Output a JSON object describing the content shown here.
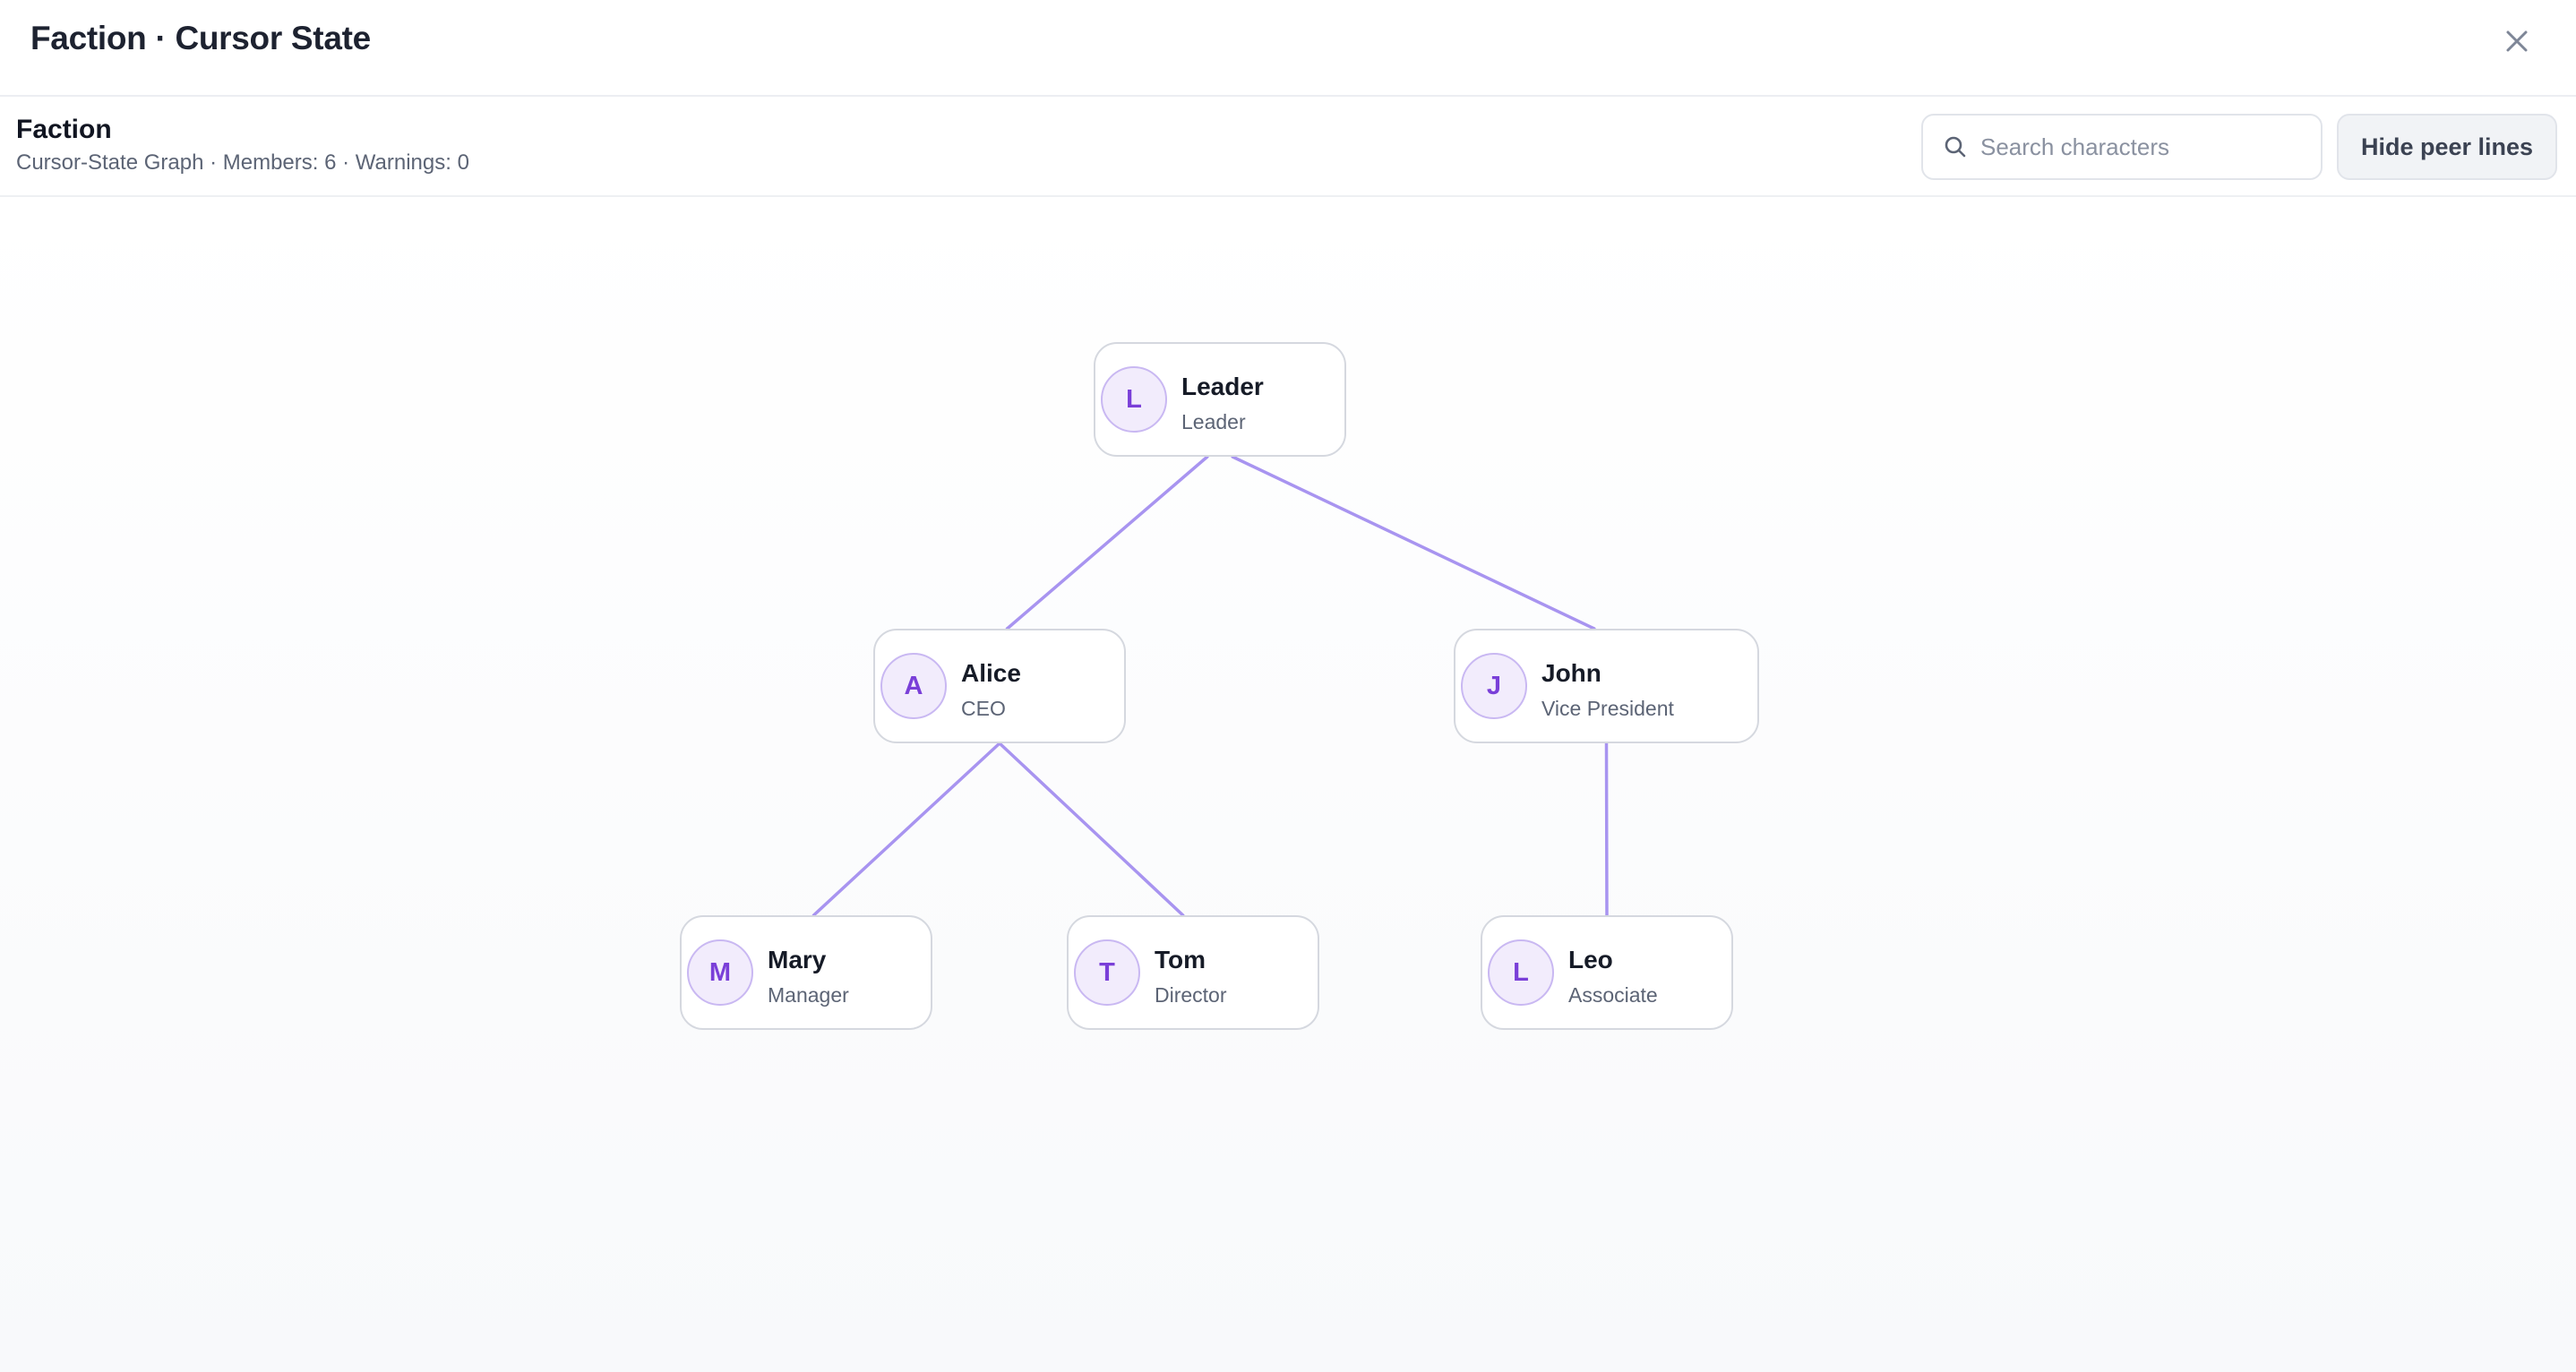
{
  "dialog": {
    "title": "Faction · Cursor State"
  },
  "toolbar": {
    "faction_name": "Faction",
    "meta": "Cursor-State Graph · Members: 6 · Warnings: 0",
    "search_placeholder": "Search characters",
    "search_value": "",
    "peer_lines_button": "Hide peer lines"
  },
  "graph": {
    "edge_color": "#a894f0",
    "avatar_color": "#7a3fd8",
    "nodes": [
      {
        "id": "leader",
        "initial": "L",
        "name": "Leader",
        "role": "Leader"
      },
      {
        "id": "alice",
        "initial": "A",
        "name": "Alice",
        "role": "CEO"
      },
      {
        "id": "john",
        "initial": "J",
        "name": "John",
        "role": "Vice President"
      },
      {
        "id": "mary",
        "initial": "M",
        "name": "Mary",
        "role": "Manager"
      },
      {
        "id": "tom",
        "initial": "T",
        "name": "Tom",
        "role": "Director"
      },
      {
        "id": "leo",
        "initial": "L",
        "name": "Leo",
        "role": "Associate"
      }
    ],
    "edges": [
      [
        "leader",
        "alice"
      ],
      [
        "leader",
        "john"
      ],
      [
        "alice",
        "mary"
      ],
      [
        "alice",
        "tom"
      ],
      [
        "john",
        "leo"
      ]
    ]
  }
}
